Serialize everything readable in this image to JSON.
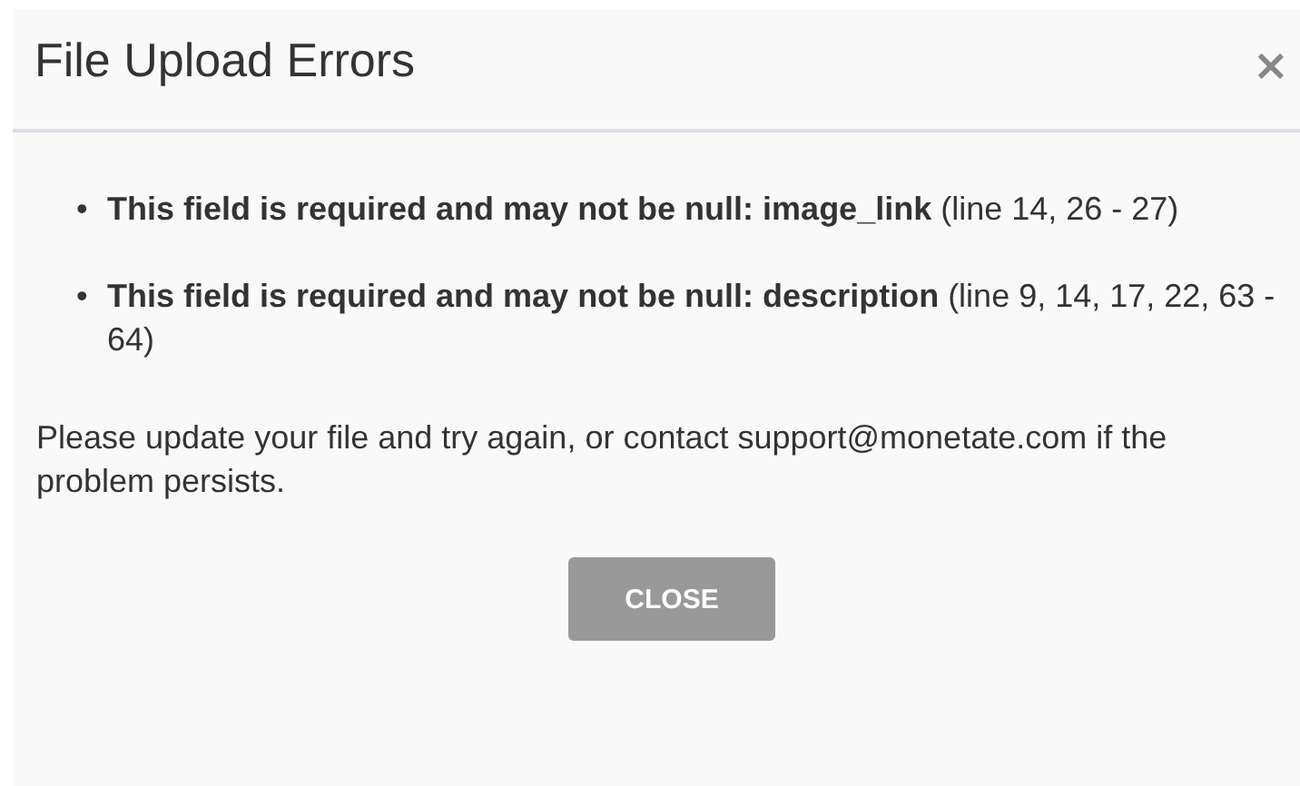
{
  "dialog": {
    "title": "File Upload Errors",
    "close_icon": "×",
    "errors": [
      {
        "bullet": "•",
        "text": "**This field is required and may not be null: image_link** (line 14, 26 - 27)"
      },
      {
        "bullet": "•",
        "text": "**This field is required and may not be null: description** (line 9, 14, 17, 22, 63 - 64)"
      }
    ],
    "message": "Please update your file and try again, or contact support@monetate.com if the problem persists.",
    "buttons": [
      "CLOSE"
    ]
  }
}
